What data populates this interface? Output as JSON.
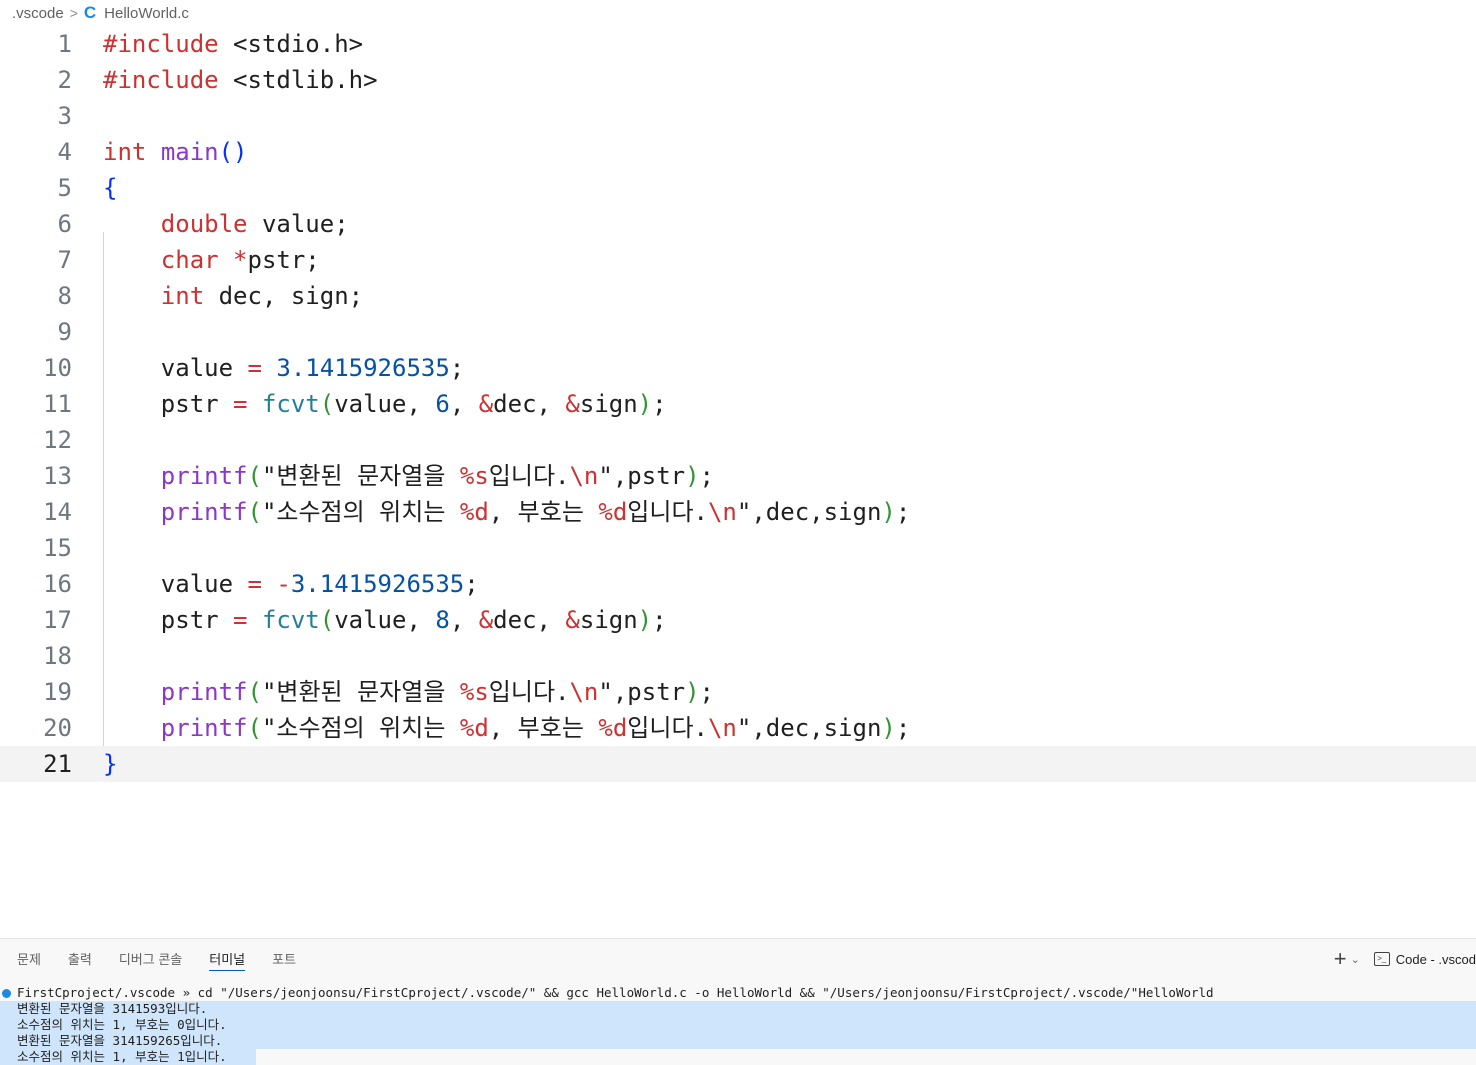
{
  "breadcrumb": {
    "folder": ".vscode",
    "separator": ">",
    "file_icon": "C",
    "file": "HelloWorld.c"
  },
  "editor": {
    "current_line": "21",
    "lines": [
      {
        "n": "1"
      },
      {
        "n": "2"
      },
      {
        "n": "3"
      },
      {
        "n": "4"
      },
      {
        "n": "5"
      },
      {
        "n": "6"
      },
      {
        "n": "7"
      },
      {
        "n": "8"
      },
      {
        "n": "9"
      },
      {
        "n": "10"
      },
      {
        "n": "11"
      },
      {
        "n": "12"
      },
      {
        "n": "13"
      },
      {
        "n": "14"
      },
      {
        "n": "15"
      },
      {
        "n": "16"
      },
      {
        "n": "17"
      },
      {
        "n": "18"
      },
      {
        "n": "19"
      },
      {
        "n": "20"
      },
      {
        "n": "21"
      }
    ],
    "code": {
      "l1_kw": "#include",
      "l1_rest": " <stdio.h>",
      "l2_kw": "#include",
      "l2_rest": " <stdlib.h>",
      "l4_kw": "int",
      "l4_fn": "main",
      "l4_paren": "()",
      "l5": "{",
      "l6_kw": "double",
      "l6_rest": " value;",
      "l7_kw": "char",
      "l7_op": " *",
      "l7_rest": "pstr;",
      "l8_kw": "int",
      "l8_rest": " dec, sign;",
      "l10_a": "value ",
      "l10_op": "=",
      "l10_num": " 3.1415926535",
      "l10_end": ";",
      "l11_a": "pstr ",
      "l11_op": "=",
      "l11_fn": " fcvt",
      "l11_p1": "(",
      "l11_b": "value, ",
      "l11_num": "6",
      "l11_c": ", ",
      "l11_amp1": "&",
      "l11_d": "dec, ",
      "l11_amp2": "&",
      "l11_e": "sign",
      "l11_p2": ")",
      "l11_end": ";",
      "l13_fn": "printf",
      "l13_p1": "(",
      "l13_s1": "\"변환된 문자열을 ",
      "l13_fmt": "%s",
      "l13_s2": "입니다.",
      "l13_esc": "\\n",
      "l13_s3": "\"",
      "l13_rest": ",pstr",
      "l13_p2": ")",
      "l13_end": ";",
      "l14_fn": "printf",
      "l14_p1": "(",
      "l14_s1": "\"소수점의 위치는 ",
      "l14_fmt1": "%d",
      "l14_s2": ", 부호는 ",
      "l14_fmt2": "%d",
      "l14_s3": "입니다.",
      "l14_esc": "\\n",
      "l14_s4": "\"",
      "l14_rest": ",dec,sign",
      "l14_p2": ")",
      "l14_end": ";",
      "l16_a": "value ",
      "l16_op": "=",
      "l16_neg": " -",
      "l16_num": "3.1415926535",
      "l16_end": ";",
      "l17_a": "pstr ",
      "l17_op": "=",
      "l17_fn": " fcvt",
      "l17_p1": "(",
      "l17_b": "value, ",
      "l17_num": "8",
      "l17_c": ", ",
      "l17_amp1": "&",
      "l17_d": "dec, ",
      "l17_amp2": "&",
      "l17_e": "sign",
      "l17_p2": ")",
      "l17_end": ";",
      "l21": "}"
    }
  },
  "panel": {
    "tabs": [
      "문제",
      "출력",
      "디버그 콘솔",
      "터미널",
      "포트"
    ],
    "active_tab": "터미널",
    "actions": {
      "add": "+",
      "dropdown": "⌄",
      "terminal_name": "Code - .vscod"
    }
  },
  "terminal": {
    "lines": [
      "FirstCproject/.vscode » cd \"/Users/jeonjoonsu/FirstCproject/.vscode/\" && gcc HelloWorld.c -o HelloWorld && \"/Users/jeonjoonsu/FirstCproject/.vscode/\"HelloWorld",
      "변환된 문자열을 3141593입니다.",
      "소수점의 위치는 1, 부호는 0입니다.",
      "변환된 문자열을 314159265입니다.",
      "소수점의 위치는 1, 부호는 1입니다."
    ]
  },
  "colors": {
    "accent": "#005fb8",
    "keyword": "#cd3131",
    "function": "#8a38c9",
    "number": "#0451a5",
    "selection": "#cfe5fb"
  }
}
